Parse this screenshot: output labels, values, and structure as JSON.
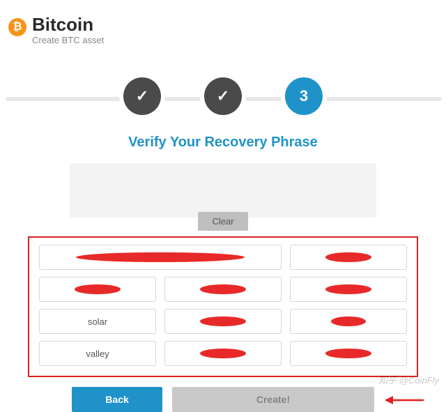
{
  "header": {
    "title": "Bitcoin",
    "subtitle": "Create BTC asset",
    "logo_glyph": "₿"
  },
  "steps": [
    {
      "label": "✓",
      "state": "done"
    },
    {
      "label": "✓",
      "state": "done"
    },
    {
      "label": "3",
      "state": "active"
    }
  ],
  "main": {
    "heading": "Verify Your Recovery Phrase",
    "clear_label": "Clear"
  },
  "words": [
    {
      "text": "",
      "redacted": true,
      "merged": true,
      "w": "w70"
    },
    {
      "text": "",
      "redacted": true,
      "w": "w40"
    },
    {
      "text": "",
      "redacted": true,
      "w": "w40"
    },
    {
      "text": "",
      "redacted": true,
      "w": "w40"
    },
    {
      "text": "",
      "redacted": true,
      "w": "w40"
    },
    {
      "text": "solar",
      "redacted": false
    },
    {
      "text": "",
      "redacted": true,
      "w": "w40"
    },
    {
      "text": "",
      "redacted": true,
      "w": "w30"
    },
    {
      "text": "valley",
      "redacted": false
    },
    {
      "text": "",
      "redacted": true,
      "w": "w40"
    },
    {
      "text": "",
      "redacted": true,
      "w": "w40"
    }
  ],
  "footer": {
    "back_label": "Back",
    "create_label": "Create!"
  },
  "watermark": "知乎 @CoinFly"
}
